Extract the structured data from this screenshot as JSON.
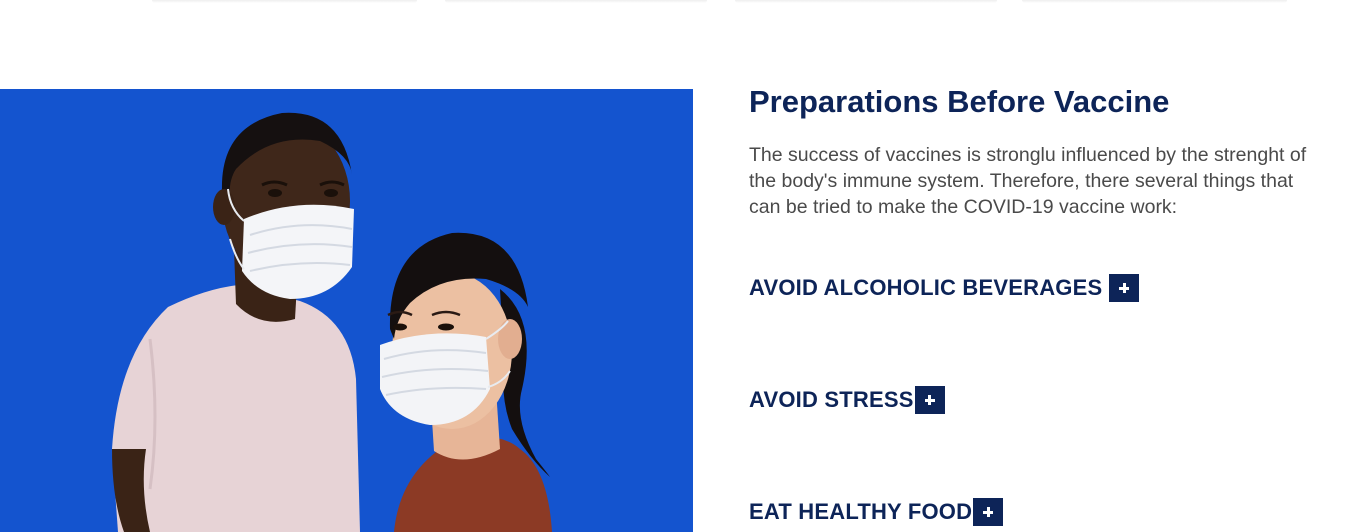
{
  "section": {
    "heading": "Preparations Before Vaccine",
    "intro": "The success of vaccines is stronglu influenced by the strenght of the body's immune system. Therefore, there several things that can be tried to make the COVID-19 vaccine work:"
  },
  "image": {
    "icon": "two-people-wearing-masks-photo",
    "background_color": "#1454cf"
  },
  "tips": [
    {
      "label": "AVOID ALCOHOLIC BEVERAGES",
      "icon": "plus-icon"
    },
    {
      "label": "AVOID STRESS",
      "icon": "plus-icon"
    },
    {
      "label": "EAT HEALTHY FOOD",
      "icon": "plus-icon"
    }
  ],
  "colors": {
    "heading": "#0d2458",
    "body_text": "#4a4a4a",
    "toggle_bg": "#0d2458"
  }
}
